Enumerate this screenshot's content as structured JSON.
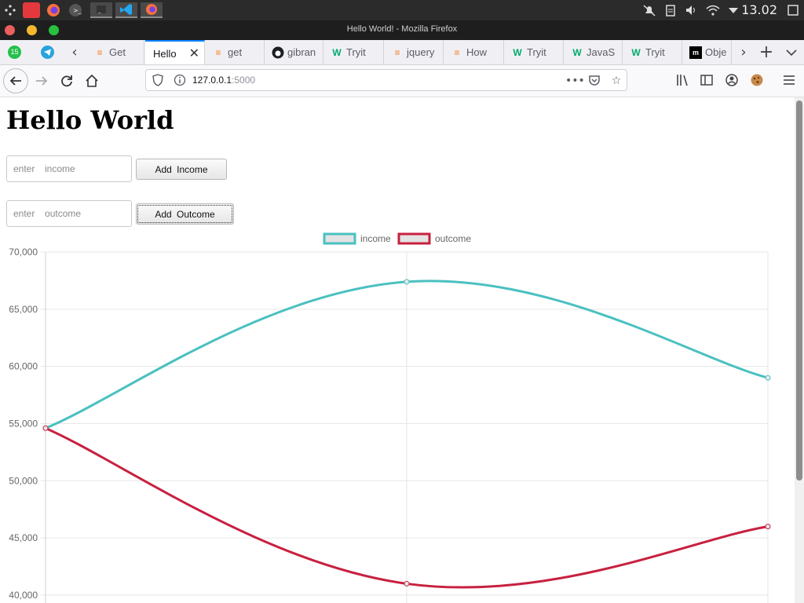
{
  "system": {
    "clock": "13.02",
    "colors": {
      "panel_bg": "#2b2b2b"
    }
  },
  "window": {
    "title": "Hello World! - Mozilla Firefox"
  },
  "tabs": [
    {
      "label": "Get",
      "icon": "stackoverflow-icon"
    },
    {
      "label": "Hello",
      "icon": "none",
      "active": true
    },
    {
      "label": "get",
      "icon": "stackoverflow-icon"
    },
    {
      "label": "gibran",
      "icon": "github-icon"
    },
    {
      "label": "Tryit",
      "icon": "w3schools-icon"
    },
    {
      "label": "jquery",
      "icon": "stackoverflow-icon"
    },
    {
      "label": "How",
      "icon": "stackoverflow-icon"
    },
    {
      "label": "Tryit",
      "icon": "w3schools-icon"
    },
    {
      "label": "JavaS",
      "icon": "w3schools-icon"
    },
    {
      "label": "Tryit",
      "icon": "w3schools-icon"
    },
    {
      "label": "Obje",
      "icon": "mdn-icon"
    }
  ],
  "tab_counter": "15",
  "address": {
    "host": "127.0.0.1",
    "port": ":5000"
  },
  "page": {
    "title": "Hello World",
    "income_placeholder": "enter  income",
    "income_button": "Add  Income",
    "outcome_placeholder": "enter  outcome",
    "outcome_button": "Add  Outcome"
  },
  "chart_data": {
    "type": "line",
    "x": [
      "",
      "",
      ""
    ],
    "ylim": [
      40000,
      70000
    ],
    "yticks": [
      "70,000",
      "65,000",
      "60,000",
      "55,000",
      "50,000",
      "45,000",
      "40,000"
    ],
    "ytick_values": [
      70000,
      65000,
      60000,
      55000,
      50000,
      45000,
      40000
    ],
    "grid": true,
    "legend_position": "top-center",
    "series": [
      {
        "name": "income",
        "values": [
          54600,
          67400,
          59000
        ],
        "color": "#4bc0c0"
      },
      {
        "name": "outcome",
        "values": [
          54600,
          41000,
          46000
        ],
        "color": "#c8203f"
      }
    ]
  }
}
